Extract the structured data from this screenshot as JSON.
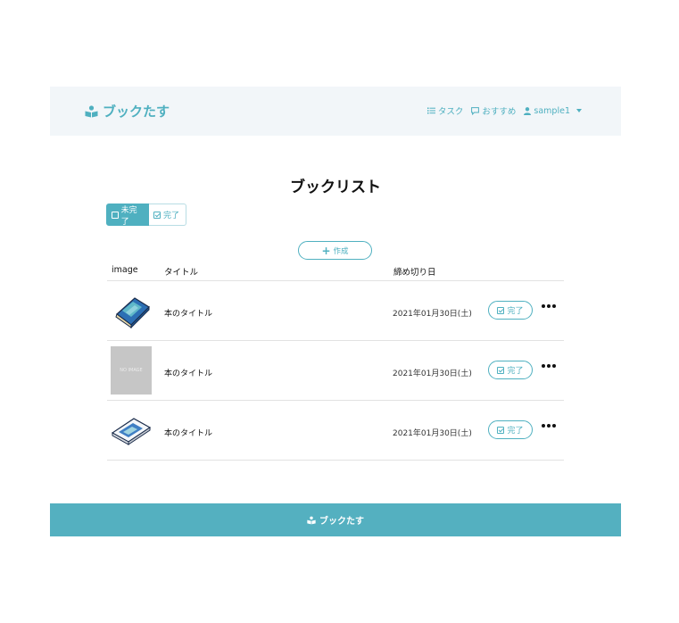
{
  "header": {
    "brand": "ブックたす",
    "nav": {
      "tasks": "タスク",
      "recommend": "おすすめ",
      "user": "sample1"
    }
  },
  "main": {
    "title": "ブックリスト",
    "tabs": [
      {
        "label": "未完了",
        "active": true
      },
      {
        "label": "完了",
        "active": false
      }
    ],
    "create_label": "作成",
    "columns": {
      "image": "image",
      "title": "タイトル",
      "deadline": "締め切り日"
    },
    "rows": [
      {
        "image": "book-illustration-blue",
        "title": "本のタイトル",
        "date": "2021年01月30日(土)",
        "done_label": "完了"
      },
      {
        "image": "no-image",
        "image_text": "NO IMAGE",
        "title": "本のタイトル",
        "date": "2021年01月30日(土)",
        "done_label": "完了"
      },
      {
        "image": "book-illustration-open",
        "title": "本のタイトル",
        "date": "2021年01月30日(土)",
        "done_label": "完了"
      }
    ]
  },
  "footer": {
    "brand": "ブックたす"
  },
  "colors": {
    "accent": "#4fb0c0",
    "header_bg": "#f2f6f9",
    "footer_bg": "#54b0c0"
  }
}
